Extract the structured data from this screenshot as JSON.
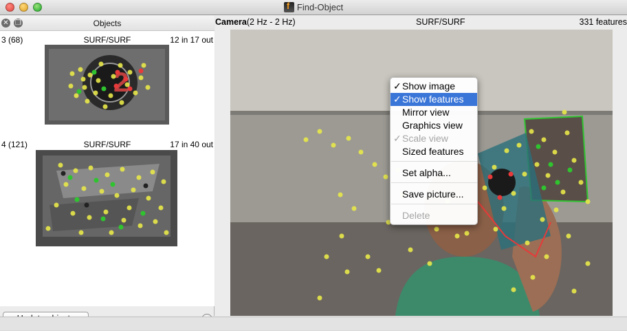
{
  "window": {
    "title": "Find-Object"
  },
  "objects_dock": {
    "title": "Objects",
    "items": [
      {
        "id_count": "3 (68)",
        "detector": "SURF/SURF",
        "stats": "12 in 17 out"
      },
      {
        "id_count": "4 (121)",
        "detector": "SURF/SURF",
        "stats": "17 in 40 out"
      }
    ],
    "update_button": "Update objects",
    "slider_value": 1.0
  },
  "camera": {
    "label": "Camera",
    "rate": "(2 Hz - 2 Hz)",
    "detector": "SURF/SURF",
    "features": "331 features"
  },
  "context_menu": {
    "items": [
      {
        "label": "Show image",
        "checked": true,
        "selected": false,
        "enabled": true
      },
      {
        "label": "Show features",
        "checked": true,
        "selected": true,
        "enabled": true
      },
      {
        "label": "Mirror view",
        "checked": false,
        "selected": false,
        "enabled": true
      },
      {
        "label": "Graphics view",
        "checked": false,
        "selected": false,
        "enabled": true
      },
      {
        "label": "Scale view",
        "checked": true,
        "selected": false,
        "enabled": false
      },
      {
        "label": "Sized features",
        "checked": false,
        "selected": false,
        "enabled": true
      },
      {
        "label": "Set alpha...",
        "checked": false,
        "selected": false,
        "enabled": true
      },
      {
        "label": "Save picture...",
        "checked": false,
        "selected": false,
        "enabled": true
      },
      {
        "label": "Delete",
        "checked": false,
        "selected": false,
        "enabled": false
      }
    ],
    "check_glyph": "✓"
  },
  "colors": {
    "feature_default": "#e8e84a",
    "feature_inlier": "#2fc42f",
    "feature_outlier": "#e83a3a",
    "selection": "#3a75d8"
  }
}
